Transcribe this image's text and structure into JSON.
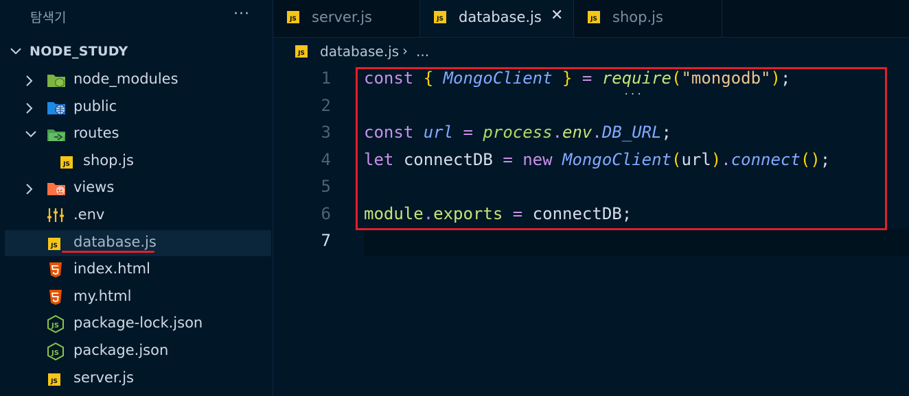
{
  "sidebar": {
    "title": "탐색기",
    "more_label": "···",
    "folder_name": "NODE_STUDY",
    "items": [
      {
        "label": "node_modules",
        "icon": "folder-node-icon"
      },
      {
        "label": "public",
        "icon": "folder-public-icon"
      },
      {
        "label": "routes",
        "icon": "folder-routes-icon"
      },
      {
        "label": "shop.js",
        "icon": "js-file-icon"
      },
      {
        "label": "views",
        "icon": "folder-views-icon"
      },
      {
        "label": ".env",
        "icon": "env-file-icon"
      },
      {
        "label": "database.js",
        "icon": "js-file-icon"
      },
      {
        "label": "index.html",
        "icon": "html-file-icon"
      },
      {
        "label": "my.html",
        "icon": "html-file-icon"
      },
      {
        "label": "package-lock.json",
        "icon": "nodejs-file-icon"
      },
      {
        "label": "package.json",
        "icon": "nodejs-file-icon"
      },
      {
        "label": "server.js",
        "icon": "js-file-icon"
      }
    ]
  },
  "tabs": [
    {
      "label": "server.js"
    },
    {
      "label": "database.js",
      "close": "✕"
    },
    {
      "label": "shop.js"
    }
  ],
  "breadcrumb": {
    "file": "database.js",
    "separator": "›",
    "more": "..."
  },
  "line_numbers": [
    "1",
    "2",
    "3",
    "4",
    "5",
    "6",
    "7"
  ],
  "icon_badge": "JS",
  "code": {
    "line1": {
      "kw": "const",
      "b1": "{",
      "cls": "MongoClient",
      "b2": "}",
      "eq": "=",
      "fn": "require",
      "p1": "(",
      "str": "\"mongodb\"",
      "p2": ")",
      "semi": ";"
    },
    "line3": {
      "kw": "const",
      "var": "url",
      "eq": "=",
      "mod": "process",
      "d1": ".",
      "prop": "env",
      "d2": ".",
      "const": "DB_URL",
      "semi": ";"
    },
    "line4": {
      "kw": "let",
      "var": "connectDB",
      "eq": "=",
      "new": "new",
      "cls": "MongoClient",
      "p1": "(",
      "arg": "url",
      "p2": ")",
      "d": ".",
      "fn": "connect",
      "p3": "(",
      "p4": ")",
      "semi": ";"
    },
    "line6": {
      "mod": "module",
      "d": ".",
      "prop": "exports",
      "eq": "=",
      "var": "connectDB",
      "semi": ";"
    }
  },
  "colors": {
    "annotation": "#e0202b",
    "background": "#011627"
  }
}
